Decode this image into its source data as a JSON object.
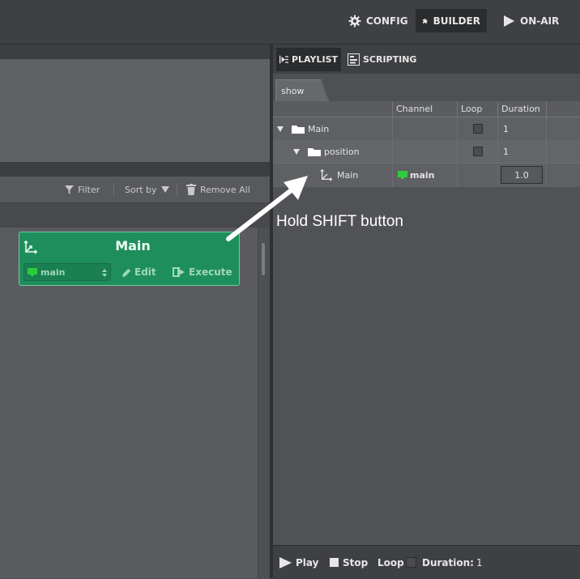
{
  "topnav": {
    "config": {
      "label": "CONFIG",
      "icon": "gear-icon"
    },
    "builder": {
      "label": "BUILDER",
      "icon": "puzzle-icon"
    },
    "onair": {
      "label": "ON-AIR",
      "icon": "play-icon"
    }
  },
  "toolbar": {
    "filter": "Filter",
    "sort_by": "Sort by",
    "remove_all": "Remove All"
  },
  "card": {
    "title": "Main",
    "channel": "main",
    "edit": "Edit",
    "execute": "Execute",
    "accent": "#1f8e5d"
  },
  "right_tabs": {
    "playlist": "PLAYLIST",
    "scripting": "SCRIPTING"
  },
  "show_tab": "show",
  "table": {
    "headers": [
      "Channel",
      "Loop",
      "Duration"
    ],
    "rows": [
      {
        "name": "Main",
        "channel": "",
        "loop": false,
        "duration": "1"
      },
      {
        "name": "position",
        "channel": "",
        "loop": false,
        "duration": "1"
      },
      {
        "name": "Main",
        "channel": "main",
        "loop": null,
        "duration": "1.0"
      }
    ]
  },
  "hint": "Hold SHIFT button",
  "bottom": {
    "play": "Play",
    "stop": "Stop",
    "loop": "Loop",
    "duration_label": "Duration:",
    "duration_value": "1"
  }
}
